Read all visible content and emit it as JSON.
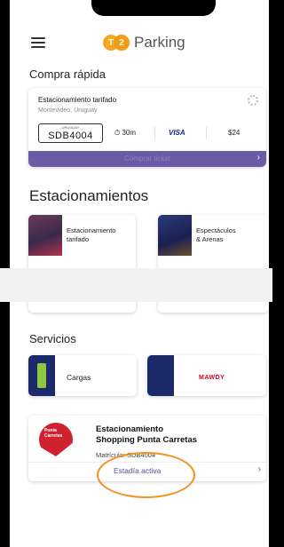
{
  "app": {
    "brand": "Parking",
    "logo_letters": [
      "T",
      "2"
    ]
  },
  "quick_buy": {
    "title": "Compra rápida",
    "parking_name": "Estacionamiento tarifado",
    "location": "Montevideo, Uruguay",
    "plate_country": "URUGUAY",
    "plate": "SDB4004",
    "duration": "30m",
    "card": "VISA",
    "price": "$24",
    "button": "Comprar ticket"
  },
  "parkings": {
    "title": "Estacionamientos",
    "items": [
      {
        "label_line1": "Estacionamiento",
        "label_line2": "tarifado"
      },
      {
        "label_line1": "Espectáculos",
        "label_line2": "& Arenas"
      }
    ]
  },
  "services": {
    "title": "Servicios",
    "items": [
      {
        "label": "Cargas"
      },
      {
        "label": "MAWDY"
      }
    ]
  },
  "active_stay": {
    "logo_text": "Punta Carretas",
    "title_line1": "Estacionamiento",
    "title_line2": "Shopping Punta Carretas",
    "plate_label": "Matrícula: SDB4004",
    "status": "Estadía activa"
  },
  "colors": {
    "accent": "#6b5aa6",
    "brand": "#f5a623",
    "highlight": "#f5911e"
  }
}
